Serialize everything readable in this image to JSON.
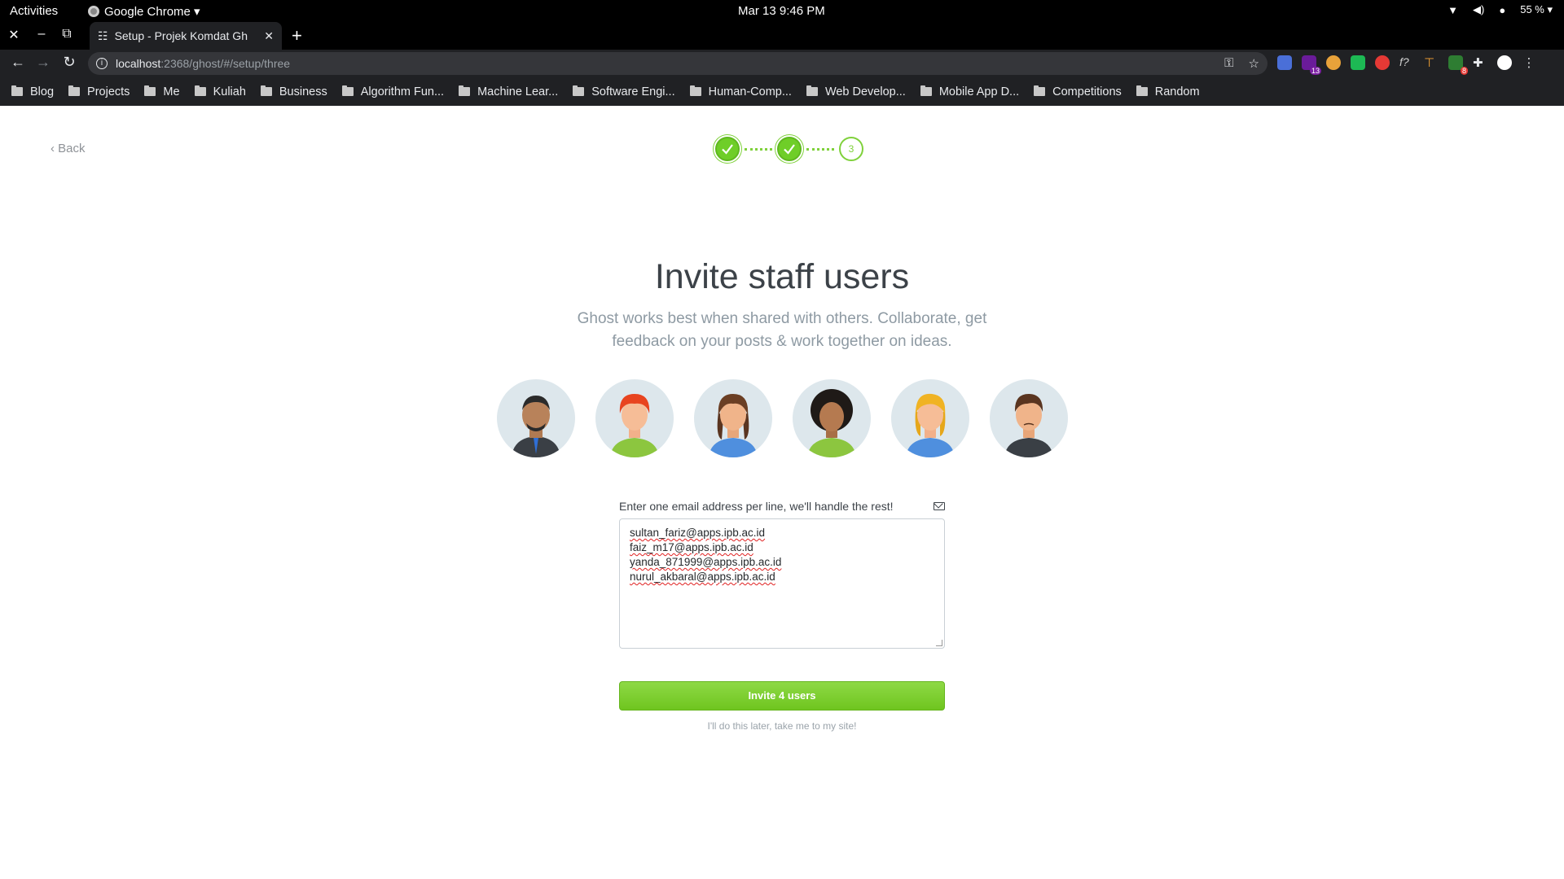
{
  "system_bar": {
    "activities": "Activities",
    "app_name": "Google Chrome ▾",
    "clock": "Mar 13  9:46 PM",
    "battery": "55 % ▾"
  },
  "browser": {
    "tab_title": "Setup - Projek Komdat Gh",
    "url_host": "localhost",
    "url_path": ":2368/ghost/#/setup/three",
    "extension_badges": [
      "13",
      "8"
    ],
    "bookmarks": [
      "Blog",
      "Projects",
      "Me",
      "Kuliah",
      "Business",
      "Algorithm Fun...",
      "Machine Lear...",
      "Software Engi...",
      "Human-Comp...",
      "Web Develop...",
      "Mobile App D...",
      "Competitions",
      "Random"
    ]
  },
  "page": {
    "back_label": "‹ Back",
    "step_current": "3",
    "heading": "Invite staff users",
    "subtitle": "Ghost works best when shared with others. Collaborate, get feedback on your posts & work together on ideas.",
    "form_label": "Enter one email address per line, we'll handle the rest!",
    "emails": [
      "sultan_fariz@apps.ipb.ac.id",
      "faiz_m17@apps.ipb.ac.id",
      "yanda_871999@apps.ipb.ac.id",
      "nurul_akbaral@apps.ipb.ac.id"
    ],
    "invite_button": "Invite 4 users",
    "skip_link": "I'll do this later, take me to my site!"
  },
  "colors": {
    "accent_green": "#7fd13b",
    "button_green": "#6fc51f",
    "avatar_bg": "#dde7ec"
  }
}
